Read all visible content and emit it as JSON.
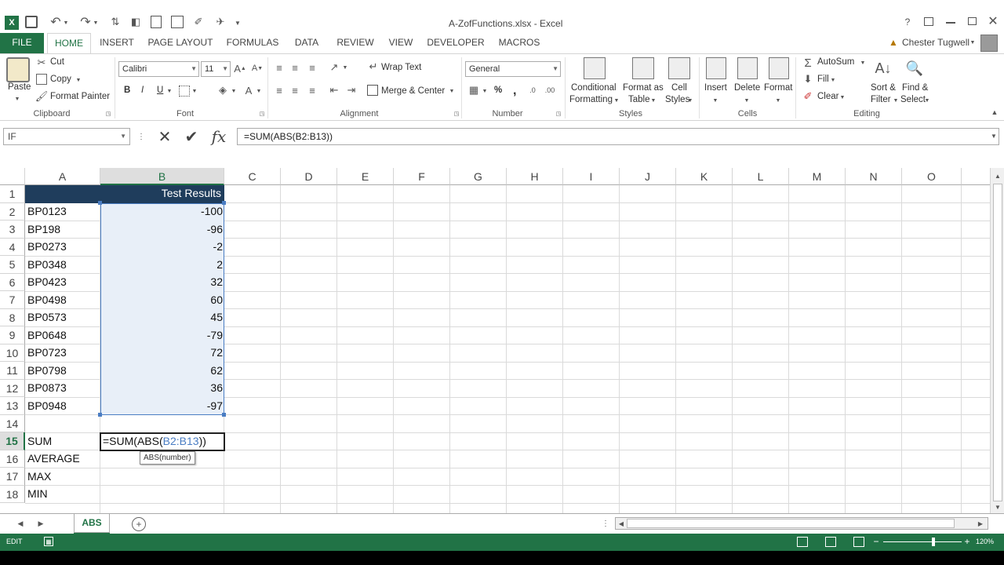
{
  "title_bar": {
    "window_title": "A-ZofFunctions.xlsx - Excel",
    "help": "?",
    "user_name": "Chester Tugwell"
  },
  "tabs": [
    {
      "label": "FILE"
    },
    {
      "label": "HOME"
    },
    {
      "label": "INSERT"
    },
    {
      "label": "PAGE LAYOUT"
    },
    {
      "label": "FORMULAS"
    },
    {
      "label": "DATA"
    },
    {
      "label": "REVIEW"
    },
    {
      "label": "VIEW"
    },
    {
      "label": "DEVELOPER"
    },
    {
      "label": "MACROS"
    }
  ],
  "ribbon": {
    "clipboard": {
      "paste": "Paste",
      "cut": "Cut",
      "copy": "Copy",
      "format_painter": "Format Painter",
      "label": "Clipboard"
    },
    "font": {
      "name": "Calibri",
      "size": "11",
      "label": "Font",
      "bold": "B",
      "italic": "I",
      "underline": "U"
    },
    "alignment": {
      "wrap_text": "Wrap Text",
      "merge_center": "Merge & Center",
      "label": "Alignment"
    },
    "number": {
      "format": "General",
      "percent": "%",
      "comma": ",",
      "label": "Number"
    },
    "styles": {
      "conditional_1": "Conditional",
      "conditional_2": "Formatting",
      "format_table_1": "Format as",
      "format_table_2": "Table",
      "cell_styles_1": "Cell",
      "cell_styles_2": "Styles",
      "label": "Styles"
    },
    "cells": {
      "insert": "Insert",
      "delete": "Delete",
      "format": "Format",
      "label": "Cells"
    },
    "editing": {
      "autosum": "AutoSum",
      "fill": "Fill",
      "clear": "Clear",
      "sort_1": "Sort &",
      "sort_2": "Filter",
      "find_1": "Find &",
      "find_2": "Select",
      "label": "Editing"
    }
  },
  "formula_bar": {
    "name_box": "IF",
    "formula": "=SUM(ABS(B2:B13))"
  },
  "columns": [
    "A",
    "B",
    "C",
    "D",
    "E",
    "F",
    "G",
    "H",
    "I",
    "J",
    "K",
    "L",
    "M",
    "N",
    "O"
  ],
  "rows": [
    "1",
    "2",
    "3",
    "4",
    "5",
    "6",
    "7",
    "8",
    "9",
    "10",
    "11",
    "12",
    "13",
    "14",
    "15",
    "16",
    "17",
    "18"
  ],
  "cells": {
    "B1": "Test Results",
    "data": [
      {
        "id": "BP0123",
        "value": "-100"
      },
      {
        "id": "BP198",
        "value": "-96"
      },
      {
        "id": "BP0273",
        "value": "-2"
      },
      {
        "id": "BP0348",
        "value": "2"
      },
      {
        "id": "BP0423",
        "value": "32"
      },
      {
        "id": "BP0498",
        "value": "60"
      },
      {
        "id": "BP0573",
        "value": "45"
      },
      {
        "id": "BP0648",
        "value": "-79"
      },
      {
        "id": "BP0723",
        "value": "72"
      },
      {
        "id": "BP0798",
        "value": "62"
      },
      {
        "id": "BP0873",
        "value": "36"
      },
      {
        "id": "BP0948",
        "value": "-97"
      }
    ],
    "A15": "SUM",
    "A16": "AVERAGE",
    "A17": "MAX",
    "A18": "MIN",
    "B15_editing": {
      "prefix": "=SUM(ABS(",
      "range": "B2:B13",
      "suffix": "))"
    },
    "tooltip": "ABS(number)"
  },
  "sheet_tabs": [
    {
      "label": "ABS"
    }
  ],
  "status_bar": {
    "mode": "EDIT",
    "zoom": "120%"
  },
  "colors": {
    "excel_green": "#217346",
    "header_fill": "#1f3d5c",
    "range_fill": "#e8eff8",
    "range_border": "#4a7dc3"
  }
}
